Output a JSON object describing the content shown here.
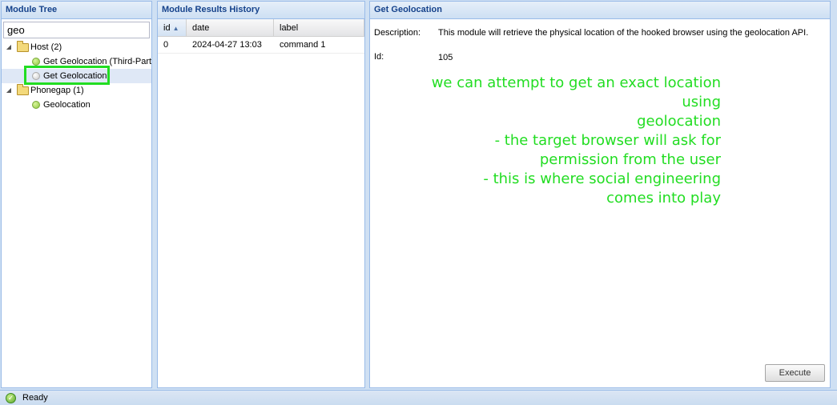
{
  "tree_panel": {
    "title": "Module Tree",
    "search_value": "geo",
    "nodes": [
      {
        "label": "Host (2)",
        "type": "folder"
      },
      {
        "label": "Get Geolocation (Third-Party)",
        "type": "module"
      },
      {
        "label": "Get Geolocation",
        "type": "module",
        "selected": true
      },
      {
        "label": "Phonegap (1)",
        "type": "folder"
      },
      {
        "label": "Geolocation",
        "type": "module"
      }
    ]
  },
  "history_panel": {
    "title": "Module Results History",
    "columns": [
      "id",
      "date",
      "label"
    ],
    "rows": [
      {
        "id": "0",
        "date": "2024-04-27 13:03",
        "label": "command 1"
      }
    ]
  },
  "detail_panel": {
    "title": "Get Geolocation",
    "description_label": "Description:",
    "description_value": "This module will retrieve the physical location of the hooked browser using the geolocation API.",
    "id_label": "Id:",
    "id_value": "105",
    "annotation_lines": [
      "we can attempt to get an exact location",
      "using",
      "geolocation",
      "- the target browser will ask for",
      "permission from the user",
      "- this is where social engineering",
      "comes into play"
    ],
    "execute_label": "Execute"
  },
  "status_bar": {
    "text": "Ready"
  },
  "colors": {
    "annotation": "#22dd22",
    "header_text": "#15428b",
    "panel_border": "#99bbe8"
  }
}
